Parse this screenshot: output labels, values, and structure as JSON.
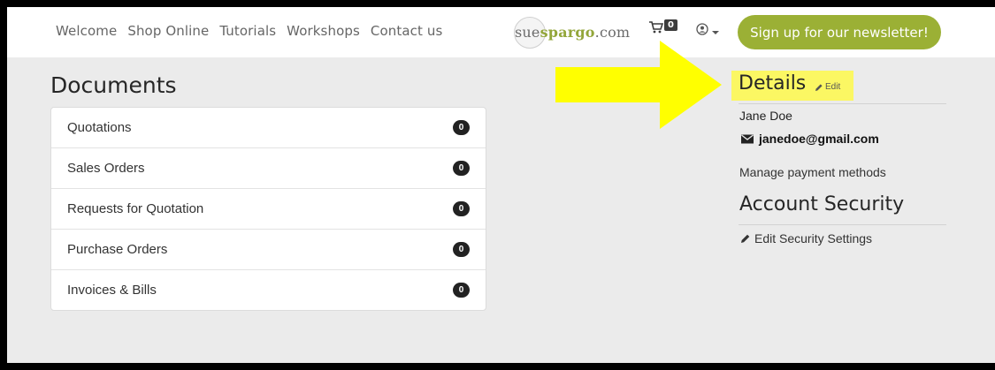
{
  "navbar": {
    "links": [
      "Welcome",
      "Shop Online",
      "Tutorials",
      "Workshops",
      "Contact us"
    ],
    "logo": {
      "part1": "sue",
      "part2": "spargo",
      "part3": ".com"
    },
    "cart_count": "0",
    "signup_label": "Sign up for our newsletter!",
    "icons": {
      "cart": "cart-icon",
      "user": "user-circle-icon",
      "caret": "caret-down-icon"
    }
  },
  "documents": {
    "title": "Documents",
    "items": [
      {
        "label": "Quotations",
        "count": "0"
      },
      {
        "label": "Sales Orders",
        "count": "0"
      },
      {
        "label": "Requests for Quotation",
        "count": "0"
      },
      {
        "label": "Purchase Orders",
        "count": "0"
      },
      {
        "label": "Invoices & Bills",
        "count": "0"
      }
    ]
  },
  "details": {
    "title": "Details",
    "edit_label": "Edit",
    "name": "Jane Doe",
    "email": "janedoe@gmail.com",
    "manage_payment": "Manage payment methods"
  },
  "security": {
    "title": "Account Security",
    "edit_label": "Edit Security Settings"
  },
  "colors": {
    "accent_green": "#9bb035",
    "highlight_yellow": "#fbf763",
    "arrow_yellow": "#ffff00",
    "background": "#ebebeb"
  }
}
